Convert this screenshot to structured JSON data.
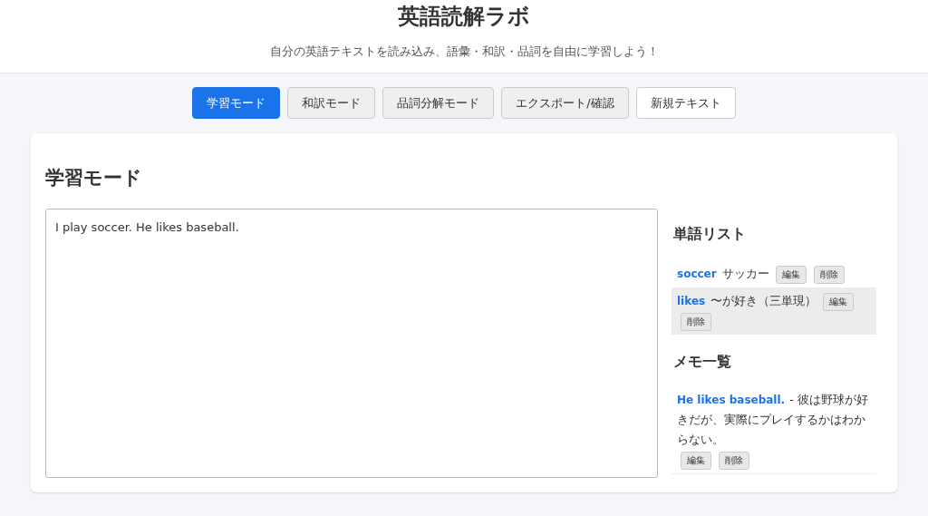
{
  "header": {
    "title": "英語読解ラボ",
    "subtitle": "自分の英語テキストを読み込み、語彙・和訳・品詞を自由に学習しよう！"
  },
  "tabs": [
    {
      "label": "学習モード",
      "selected": true
    },
    {
      "label": "和訳モード",
      "selected": false
    },
    {
      "label": "品詞分解モード",
      "selected": false
    },
    {
      "label": "エクスポート/確認",
      "selected": false
    }
  ],
  "new_text_button": "新規テキスト",
  "panel": {
    "heading": "学習モード",
    "text": "I play soccer. He likes baseball.",
    "word_list": {
      "heading": "単語リスト",
      "items": [
        {
          "word": "soccer",
          "meaning": "サッカー",
          "highlighted": false,
          "buttons": [
            "編集",
            "削除"
          ]
        },
        {
          "word": "likes",
          "meaning": "〜が好き（三単現）",
          "highlighted": true,
          "buttons": [
            "編集",
            "削除"
          ]
        }
      ]
    },
    "memo_list": {
      "heading": "メモ一覧",
      "items": [
        {
          "phrase": "He likes baseball.",
          "note": "- 彼は野球が好きだが、実際にプレイするかはわからない。",
          "buttons": [
            "編集",
            "削除"
          ]
        }
      ]
    }
  }
}
